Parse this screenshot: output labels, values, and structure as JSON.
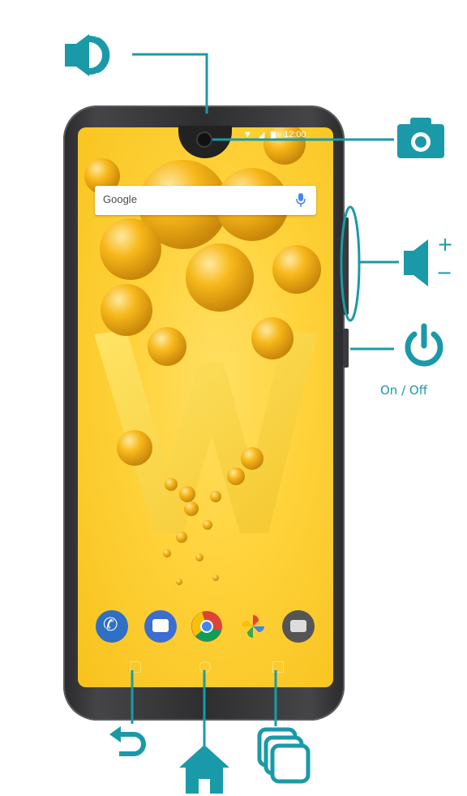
{
  "colors": {
    "accent": "#1a9aa8",
    "phone_frame": "#303033",
    "screen_yellow": "#ffd23a"
  },
  "phone": {
    "search_bar": {
      "text": "Google",
      "mic_icon": "microphone-icon"
    },
    "status_bar": {
      "time": "12:00"
    },
    "dock_apps": [
      "phone-app-icon",
      "messages-app-icon",
      "chrome-app-icon",
      "photos-app-icon",
      "camera-app-icon"
    ]
  },
  "callouts": {
    "earpiece": {
      "icon": "speaker-icon"
    },
    "front_camera": {
      "icon": "camera-icon"
    },
    "volume": {
      "icon": "volume-rocker-icon",
      "plus": "+",
      "minus": "−"
    },
    "power": {
      "icon": "power-icon",
      "label": "On / Off"
    },
    "back": {
      "icon": "back-arrow-icon"
    },
    "home": {
      "icon": "home-icon"
    },
    "recents": {
      "icon": "recent-apps-icon"
    }
  }
}
